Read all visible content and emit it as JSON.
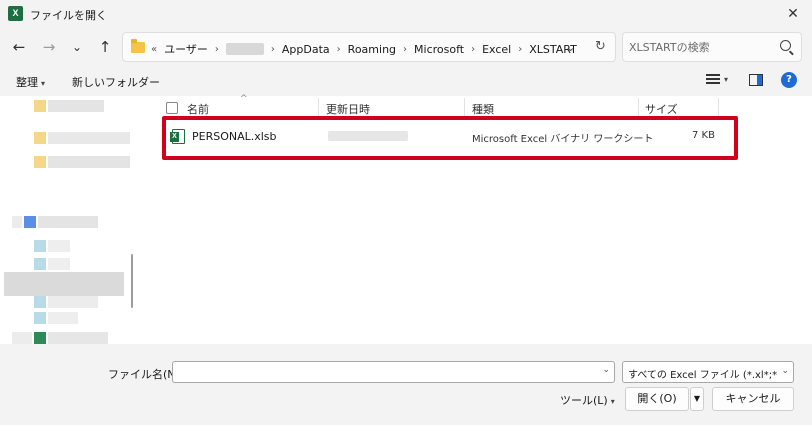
{
  "window": {
    "title": "ファイルを開く",
    "app_icon_letter": "X",
    "close_glyph": "✕"
  },
  "nav": {
    "back_glyph": "←",
    "forward_glyph": "→",
    "recent_glyph": "⌄",
    "up_glyph": "↑",
    "path": [
      {
        "label": "ユーザー",
        "blurred": false
      },
      {
        "label": "",
        "blurred": true
      },
      {
        "label": "AppData",
        "blurred": false
      },
      {
        "label": "Roaming",
        "blurred": false
      },
      {
        "label": "Microsoft",
        "blurred": false
      },
      {
        "label": "Excel",
        "blurred": false
      },
      {
        "label": "XLSTART",
        "blurred": false
      }
    ],
    "path_prefix": "«",
    "path_separator": "›",
    "dropdown_glyph": "⌄",
    "refresh_glyph": "↻",
    "search_placeholder": "XLSTARTの検索"
  },
  "toolbar": {
    "organize_label": "整理",
    "new_folder_label": "新しいフォルダー",
    "dropdown_glyph": "▾",
    "help_glyph": "?"
  },
  "columns": {
    "name": "名前",
    "date": "更新日時",
    "type": "種類",
    "size": "サイズ",
    "sort_glyph": "^"
  },
  "files": [
    {
      "name": "PERSONAL.xlsb",
      "type": "Microsoft Excel バイナリ ワークシート",
      "size": "7 KB"
    }
  ],
  "footer": {
    "filename_label": "ファイル名(N):",
    "filename_value": "",
    "filename_dropdown_glyph": "⌄",
    "filter_value": "すべての Excel ファイル (*.xl*;*.xlsx;*.xlsm;*.xlsb;*.xlam;*.xltx;*.xltm;*.xls;*.xla;*.xlt;*.xlm;*.xlw)",
    "filter_dropdown_glyph": "⌄",
    "tools_label": "ツール(L)",
    "tools_dropdown_glyph": "▾",
    "open_label": "開く(O)",
    "open_dropdown_glyph": "▼",
    "cancel_label": "キャンセル"
  },
  "colors": {
    "highlight": "#d0021b",
    "accent": "#1f6bd6",
    "excel_green": "#1d6f42"
  }
}
